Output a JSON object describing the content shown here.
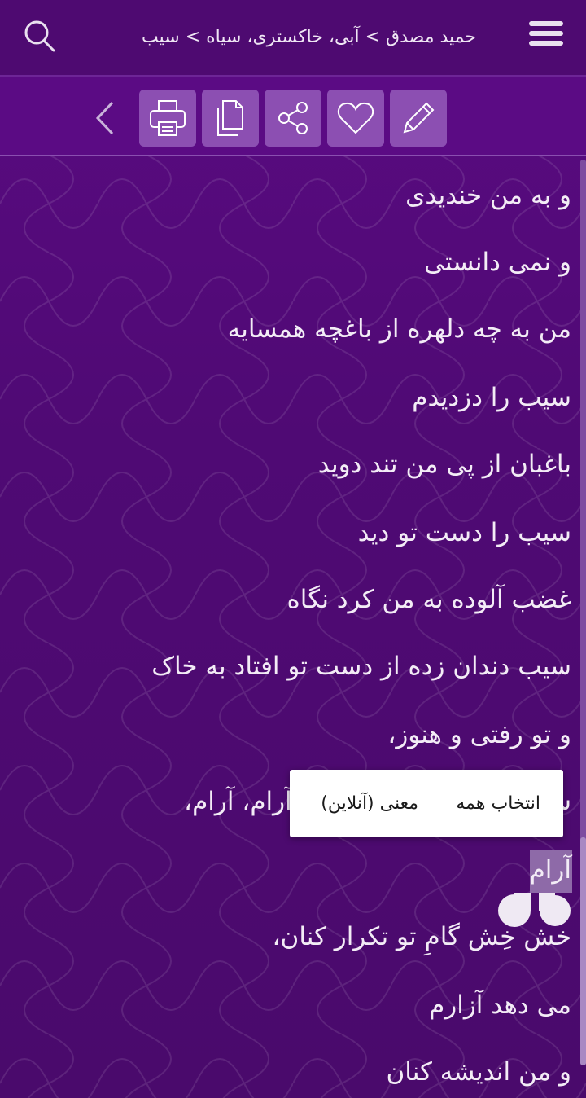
{
  "header": {
    "breadcrumb": "حمید مصدق > آبی، خاکستری، سیاه > سیب",
    "search_icon": "search-icon",
    "menu_icon": "hamburger-menu-icon"
  },
  "toolbar": {
    "buttons": [
      "edit-icon",
      "heart-icon",
      "share-icon",
      "copy-icon",
      "print-icon"
    ],
    "back_icon": "chevron-left-icon"
  },
  "poem": {
    "lines": [
      "و به من خندیدی",
      "و نمی دانستی",
      "من به چه دلهره از باغچه همسایه",
      "سیب را دزدیدم",
      "باغبان از پی من تند دوید",
      "سیب را دست تو دید",
      "غضب آلوده به من کرد نگاه",
      "سیب دندان زده از دست تو افتاد به خاک",
      "و تو رفتی و هنوز،",
      "سالهاست که در گوش من آرام، آرام،",
      "آرام",
      "خش خِش گامِ  تو تکرار کنان،",
      "می دهد آزارم",
      "و من اندیشه کنان"
    ],
    "selected_word": "آرام"
  },
  "context_menu": {
    "select_all": "انتخاب همه",
    "meaning_online": "معنی (آنلاین)"
  },
  "colors": {
    "background": "#4f0a74",
    "toolbar_button": "#8c4fb2",
    "text": "#f3ecf6"
  }
}
